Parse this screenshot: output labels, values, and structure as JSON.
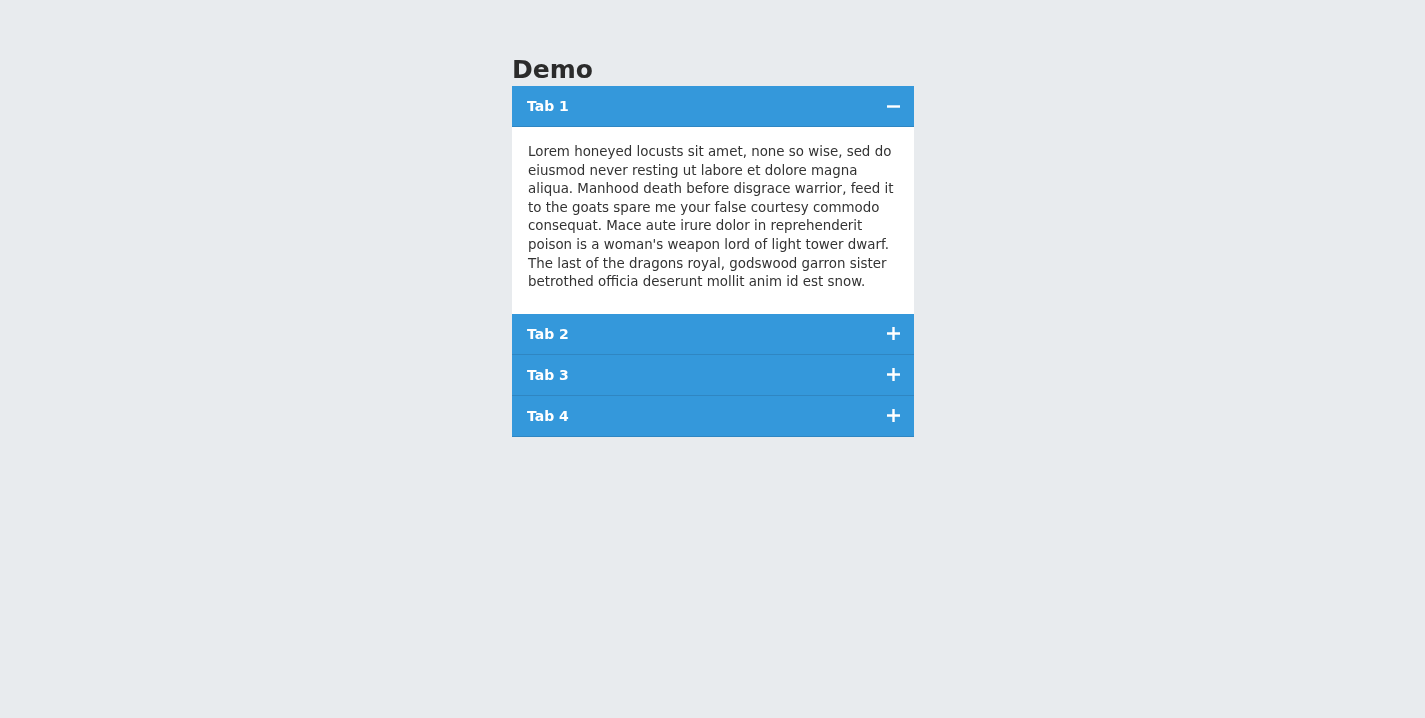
{
  "title": "Demo",
  "tabs": [
    {
      "label": "Tab 1",
      "expanded": true,
      "content": "Lorem honeyed locusts sit amet, none so wise, sed do eiusmod never resting ut labore et dolore magna aliqua. Manhood death before disgrace warrior, feed it to the goats spare me your false courtesy commodo consequat. Mace aute irure dolor in reprehenderit poison is a woman's weapon lord of light tower dwarf. The last of the dragons royal, godswood garron sister betrothed officia deserunt mollit anim id est snow."
    },
    {
      "label": "Tab 2",
      "expanded": false
    },
    {
      "label": "Tab 3",
      "expanded": false
    },
    {
      "label": "Tab 4",
      "expanded": false
    }
  ]
}
